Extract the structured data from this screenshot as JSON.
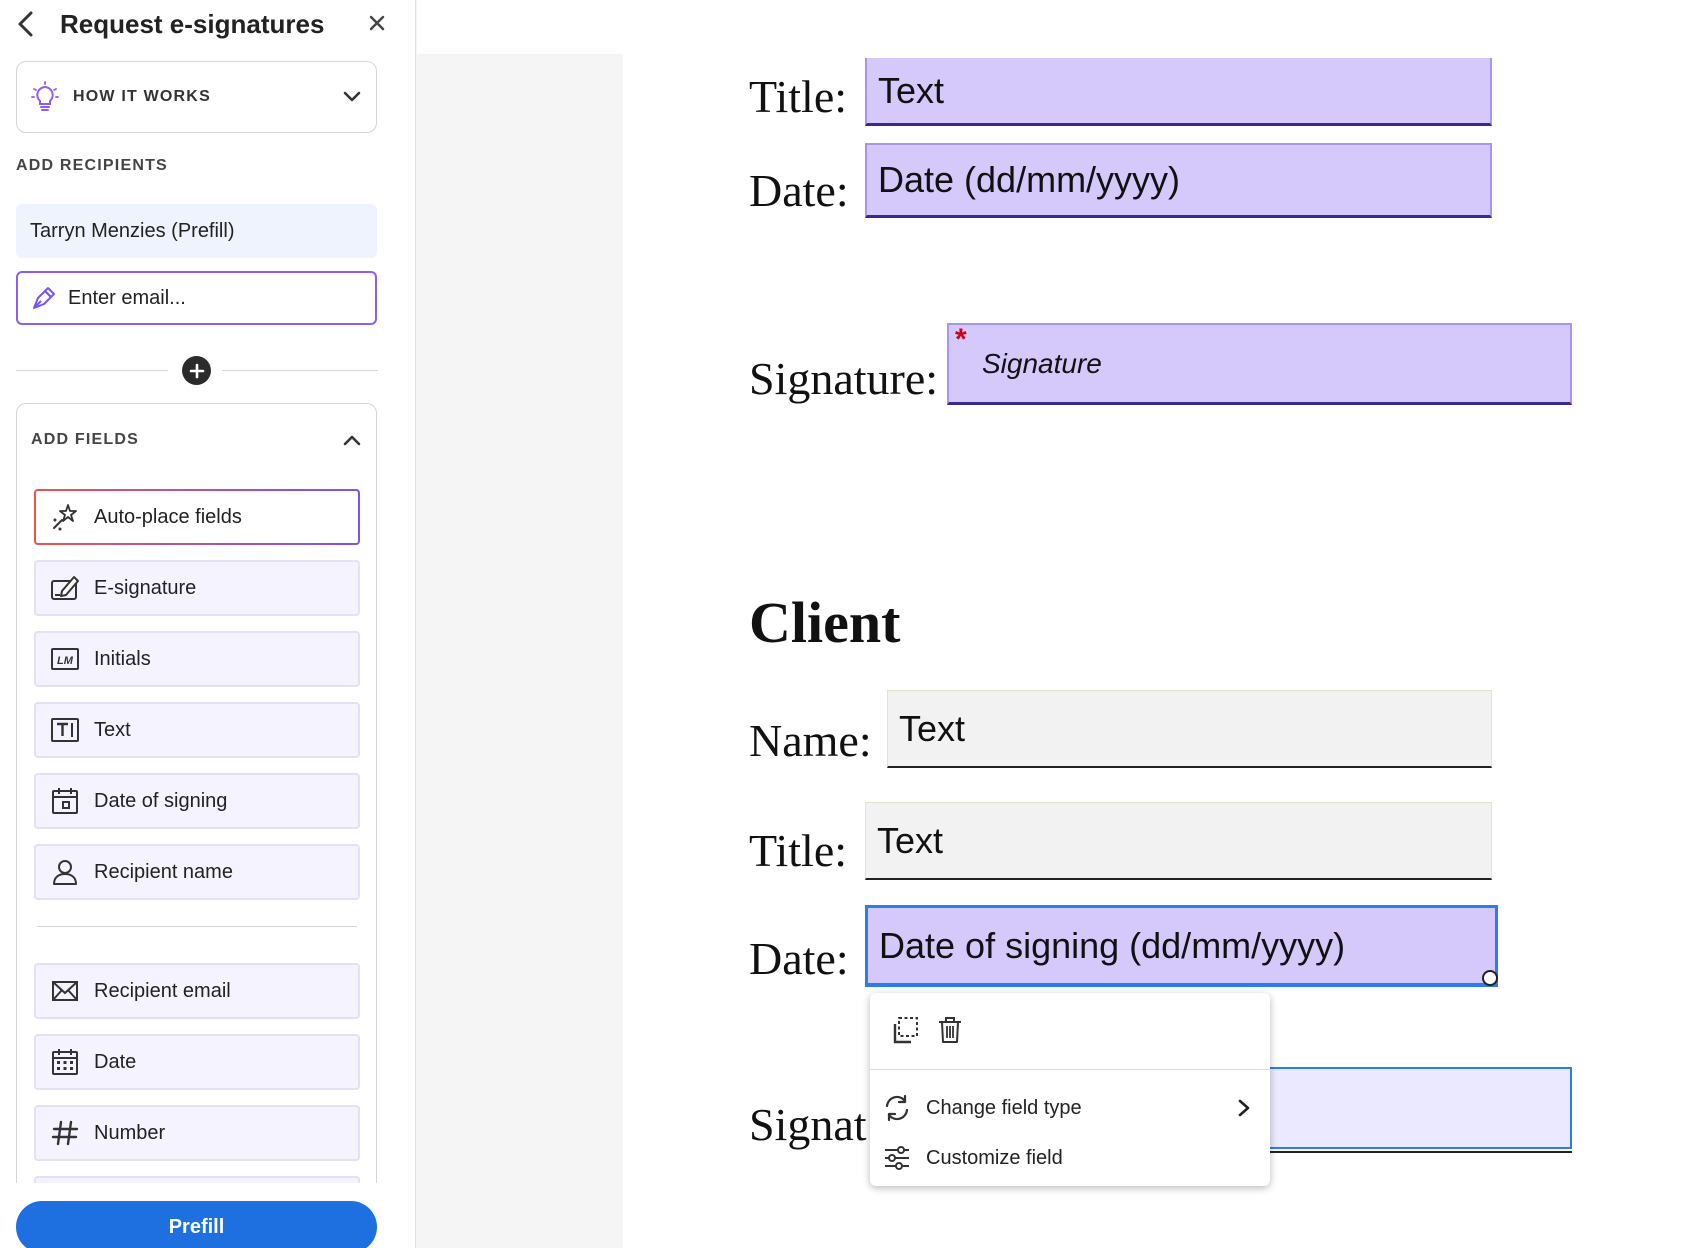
{
  "panel": {
    "title": "Request e-signatures",
    "how_it_works": "HOW IT WORKS",
    "add_recipients_label": "ADD RECIPIENTS",
    "recipient": "Tarryn Menzies (Prefill)",
    "email_placeholder": "Enter email...",
    "add_fields_label": "ADD FIELDS",
    "fields": [
      {
        "label": "Auto-place fields",
        "icon": "auto-place-icon"
      },
      {
        "label": "E-signature",
        "icon": "e-signature-icon"
      },
      {
        "label": "Initials",
        "icon": "initials-icon"
      },
      {
        "label": "Text",
        "icon": "text-field-icon"
      },
      {
        "label": "Date of signing",
        "icon": "calendar-icon"
      },
      {
        "label": "Recipient name",
        "icon": "person-icon"
      },
      {
        "label": "Recipient email",
        "icon": "envelope-icon"
      },
      {
        "label": "Date",
        "icon": "calendar-grid-icon"
      },
      {
        "label": "Number",
        "icon": "hash-icon"
      }
    ],
    "prefill_label": "Prefill"
  },
  "document": {
    "top_title_label": "Title:",
    "top_title_field": "Text",
    "top_date_label": "Date:",
    "top_date_field": "Date (dd/mm/yyyy)",
    "signature_label": "Signature:",
    "signature_required_mark": "*",
    "signature_field": "Signature",
    "client_heading": "Client",
    "client_name_label": "Name:",
    "client_name_field": "Text",
    "client_title_label": "Title:",
    "client_title_field": "Text",
    "client_date_label": "Date:",
    "client_date_field": "Date of signing (dd/mm/yyyy)",
    "client_signature_label": "Signat"
  },
  "context_menu": {
    "change_field_type": "Change field type",
    "customize_field": "Customize field"
  },
  "colors": {
    "accent": "#1e6fe0",
    "field_fill": "#d5c8fb",
    "selected_border": "#2b7de9",
    "required": "#d0021b"
  }
}
